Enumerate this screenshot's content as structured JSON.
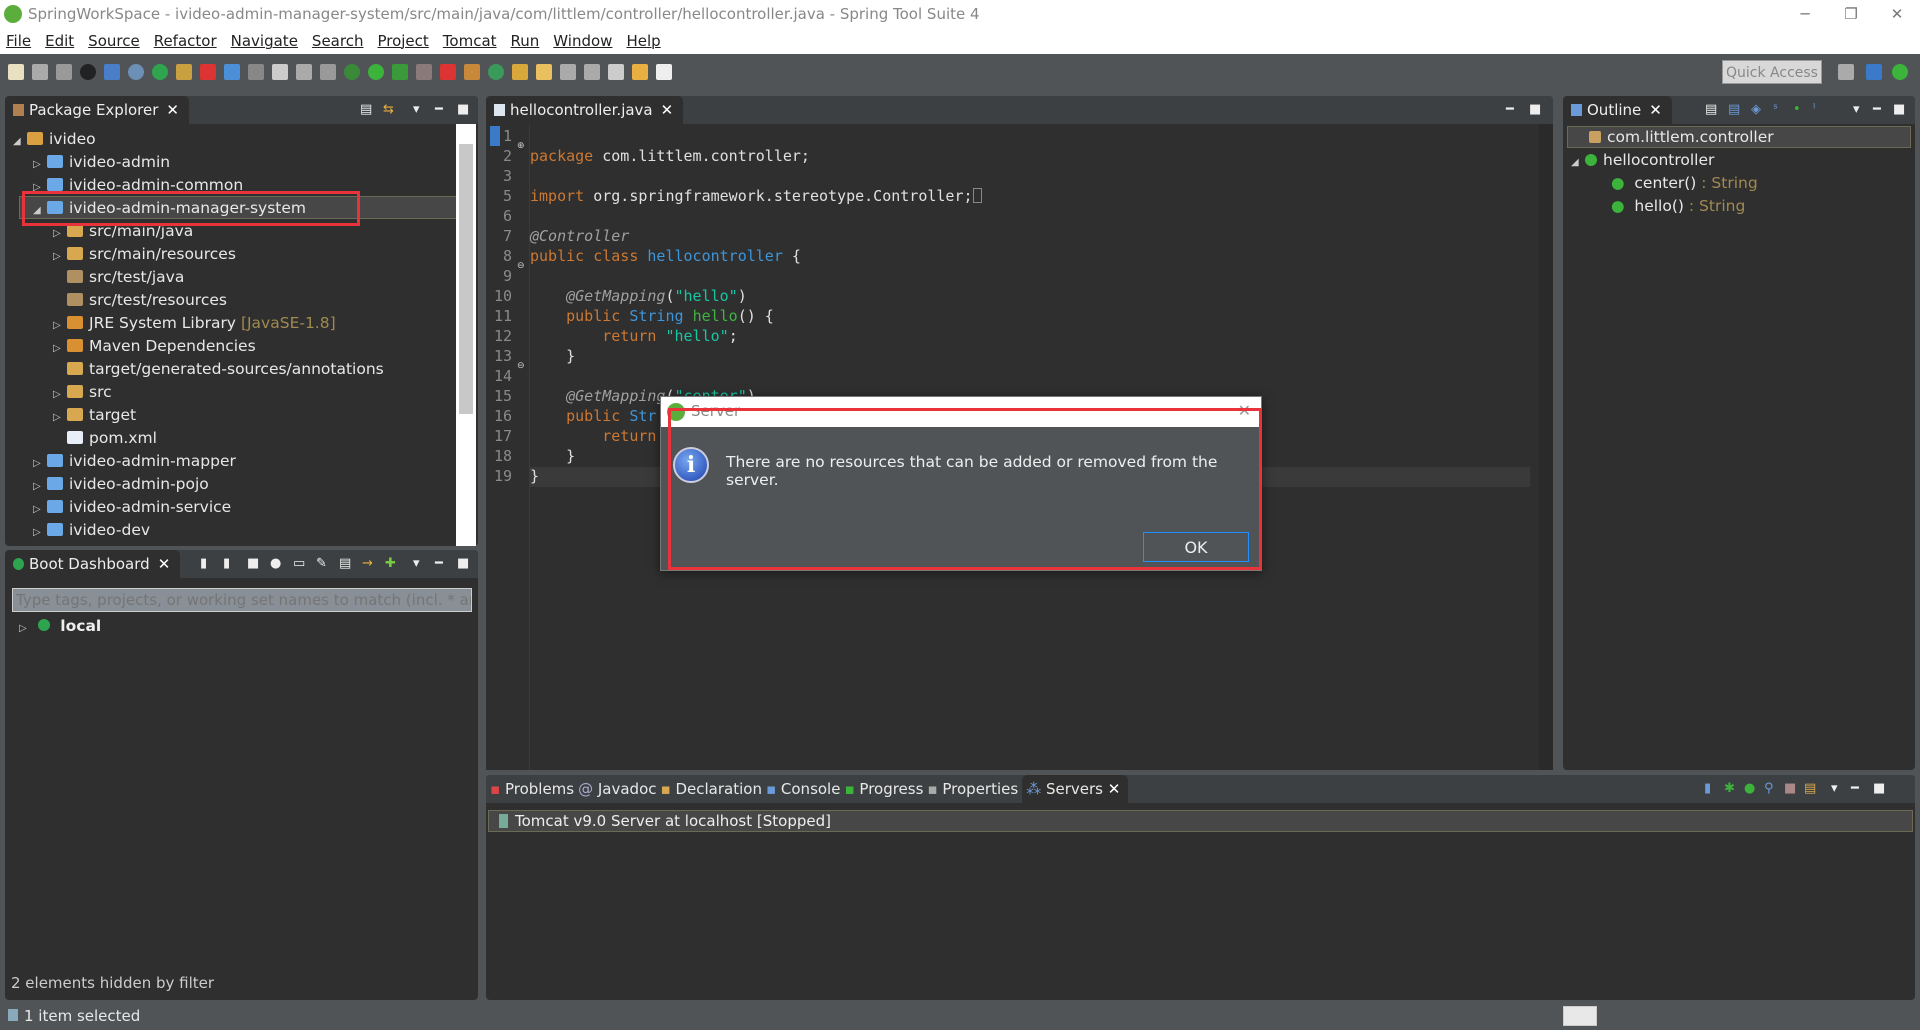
{
  "window": {
    "title": "SpringWorkSpace - ivideo-admin-manager-system/src/main/java/com/littlem/controller/hellocontroller.java - Spring Tool Suite 4",
    "minimize": "─",
    "restore": "❐",
    "close": "✕"
  },
  "menu": [
    "File",
    "Edit",
    "Source",
    "Refactor",
    "Navigate",
    "Search",
    "Project",
    "Tomcat",
    "Run",
    "Window",
    "Help"
  ],
  "toolbar": {
    "quick_access": "Quick Access"
  },
  "package_explorer": {
    "tab": "Package Explorer",
    "items": [
      {
        "label": "ivideo",
        "level": 0,
        "expanded": true
      },
      {
        "label": "ivideo-admin",
        "level": 1
      },
      {
        "label": "ivideo-admin-common",
        "level": 1
      },
      {
        "label": "ivideo-admin-manager-system",
        "level": 1,
        "expanded": true,
        "selected": true
      },
      {
        "label": "src/main/java",
        "level": 2
      },
      {
        "label": "src/main/resources",
        "level": 2
      },
      {
        "label": "src/test/java",
        "level": 2
      },
      {
        "label": "src/test/resources",
        "level": 2
      },
      {
        "label": "JRE System Library",
        "suffix": "[JavaSE-1.8]",
        "level": 2
      },
      {
        "label": "Maven Dependencies",
        "level": 2
      },
      {
        "label": "target/generated-sources/annotations",
        "level": 2
      },
      {
        "label": "src",
        "level": 2
      },
      {
        "label": "target",
        "level": 2
      },
      {
        "label": "pom.xml",
        "level": 2
      },
      {
        "label": "ivideo-admin-mapper",
        "level": 1
      },
      {
        "label": "ivideo-admin-pojo",
        "level": 1
      },
      {
        "label": "ivideo-admin-service",
        "level": 1
      },
      {
        "label": "ivideo-dev",
        "level": 1
      }
    ]
  },
  "boot_dashboard": {
    "tab": "Boot Dashboard",
    "filter_placeholder": "Type tags, projects, or working set names to match (incl. * and",
    "items": [
      "local"
    ],
    "footer": "2 elements hidden by filter"
  },
  "editor": {
    "tab": "hellocontroller.java",
    "lines": [
      "1",
      "2",
      "3",
      "5",
      "6",
      "7",
      "8",
      "9",
      "10",
      "11",
      "12",
      "13",
      "14",
      "15",
      "16",
      "17",
      "18",
      "19"
    ],
    "code": {
      "l1a": "package",
      "l1b": " com.littlem.controller;",
      "l3a": "import",
      "l3b": " org.springframework.stereotype.Controller;",
      "l6": "@Controller",
      "l7a": "public class",
      "l7b": "hellocontroller",
      "l7c": " {",
      "l9a": "    @GetMapping",
      "l9b": "(",
      "l9c": "\"hello\"",
      "l9d": ")",
      "l10a": "    public ",
      "l10b": "String",
      "l10c": "hello",
      "l10d": "() {",
      "l11a": "        return ",
      "l11b": "\"hello\"",
      "l11c": ";",
      "l12": "    }",
      "l14a": "    @GetMapping",
      "l14b": "(",
      "l14c": "\"center\"",
      "l14d": ")",
      "l15a": "    public ",
      "l15b": "Str",
      "l16a": "        return",
      "l17": "    }",
      "l18": "}"
    }
  },
  "outline": {
    "tab": "Outline",
    "items": [
      {
        "label": "com.littlem.controller"
      },
      {
        "label": "hellocontroller"
      },
      {
        "label": "center()",
        "type": " : String"
      },
      {
        "label": "hello()",
        "type": " : String"
      }
    ]
  },
  "bottom": {
    "tabs": [
      "Problems",
      "Javadoc",
      "Declaration",
      "Console",
      "Progress",
      "Properties",
      "Servers"
    ],
    "active": "Servers",
    "server": "Tomcat v9.0 Server at localhost  [Stopped]"
  },
  "dialog": {
    "title": "Server",
    "message": "There are no resources that can be added or removed from the server.",
    "ok": "OK",
    "close": "✕"
  },
  "status": {
    "text": "1 item selected"
  },
  "colors": {
    "highlight": "#e8333a",
    "keyword": "#cc7832",
    "string": "#17c6a3",
    "class": "#3e95d8"
  }
}
